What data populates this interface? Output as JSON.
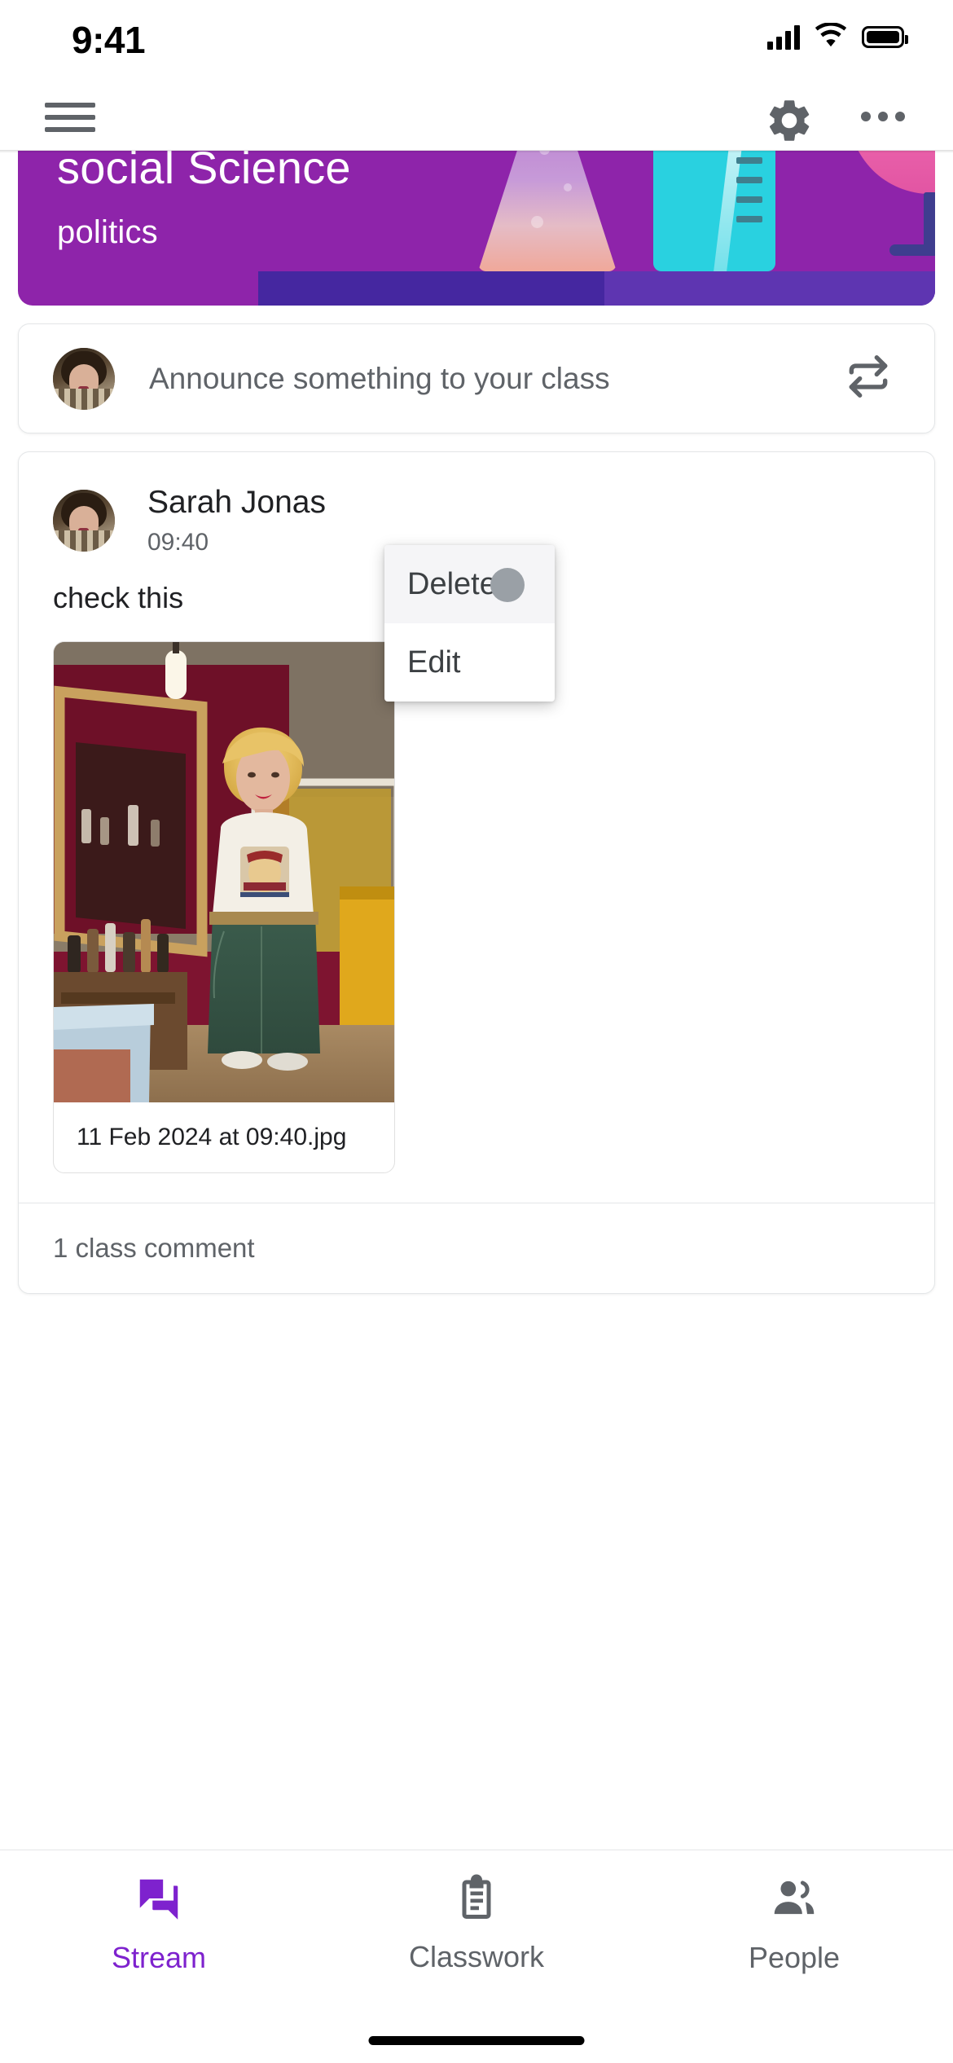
{
  "status_bar": {
    "time": "9:41",
    "signal_icon": "cellular-signal-icon",
    "wifi_icon": "wifi-icon",
    "battery_icon": "battery-full-icon"
  },
  "app_bar": {
    "menu_icon": "hamburger-menu-icon",
    "settings_icon": "gear-icon",
    "overflow_icon": "more-options-icon"
  },
  "class_banner": {
    "title": "social Science",
    "subtitle": "politics",
    "theme_color": "#8e24aa",
    "artwork": [
      "flask-icon",
      "test-tube-icon",
      "wine-glass-icon"
    ]
  },
  "announcement": {
    "placeholder": "Announce something to your class",
    "avatar": "user-avatar",
    "action_icon": "swap-arrows-icon"
  },
  "post": {
    "author": "Sarah Jonas",
    "time": "09:40",
    "text": "check this",
    "attachment": {
      "filename": "11 Feb 2024 at 09:40.jpg",
      "preview": "photo-woman-in-barbershop"
    },
    "comments_label": "1 class comment"
  },
  "context_menu": {
    "items": [
      {
        "label": "Delete",
        "pressed": true
      },
      {
        "label": "Edit",
        "pressed": false
      }
    ],
    "touch_indicator": "touch-point-indicator"
  },
  "bottom_nav": {
    "active_color": "#7e22ce",
    "items": [
      {
        "label": "Stream",
        "icon": "stream-icon",
        "active": true
      },
      {
        "label": "Classwork",
        "icon": "clipboard-icon",
        "active": false
      },
      {
        "label": "People",
        "icon": "people-icon",
        "active": false
      }
    ]
  }
}
